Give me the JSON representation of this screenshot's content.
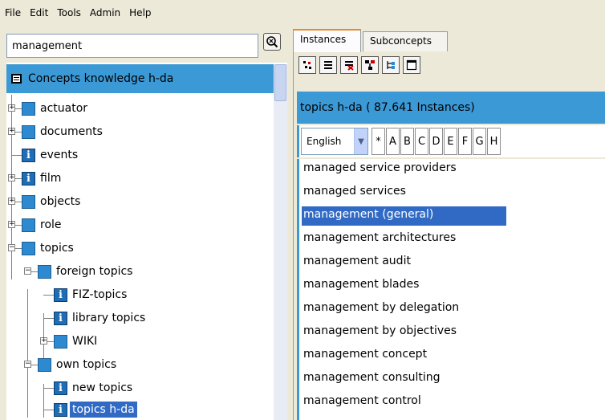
{
  "menubar": {
    "items": [
      "File",
      "Edit",
      "Tools",
      "Admin",
      "Help"
    ]
  },
  "search": {
    "value": "management",
    "button_icon": "search-icon"
  },
  "tree": {
    "root_label": "Concepts knowledge h-da",
    "nodes": [
      {
        "label": "actuator",
        "type": "folder",
        "expandable": true
      },
      {
        "label": "documents",
        "type": "folder",
        "expandable": true
      },
      {
        "label": "events",
        "type": "info",
        "expandable": false
      },
      {
        "label": "film",
        "type": "info",
        "expandable": true
      },
      {
        "label": "objects",
        "type": "folder",
        "expandable": true
      },
      {
        "label": "role",
        "type": "folder",
        "expandable": true
      },
      {
        "label": "topics",
        "type": "folder",
        "expandable": true,
        "expanded": true
      },
      {
        "label": "foreign topics",
        "type": "folder",
        "expanded": true
      },
      {
        "label": "FIZ-topics",
        "type": "info"
      },
      {
        "label": "library topics",
        "type": "info"
      },
      {
        "label": "WIKI",
        "type": "folder",
        "expandable": true
      },
      {
        "label": "own topics",
        "type": "folder",
        "expanded": true
      },
      {
        "label": "new topics",
        "type": "info"
      },
      {
        "label": "topics h-da",
        "type": "info",
        "selected": true
      }
    ]
  },
  "tabs": [
    {
      "label": "Instances",
      "active": true
    },
    {
      "label": "Subconcepts",
      "active": false
    }
  ],
  "instances": {
    "header": "topics h-da ( 87.641 Instances)",
    "language": "English",
    "letters": [
      "*",
      "A",
      "B",
      "C",
      "D",
      "E",
      "F",
      "G",
      "H"
    ],
    "items": [
      "managed service providers",
      "managed services",
      "management (general)",
      "management architectures",
      "management audit",
      "management blades",
      "management by delegation",
      "management by objectives",
      "management concept",
      "management consulting",
      "management control"
    ],
    "selected_index": 2
  },
  "colors": {
    "accent": "#3b99d6",
    "selection": "#316ac5",
    "tab_highlight": "#e68b2c"
  }
}
